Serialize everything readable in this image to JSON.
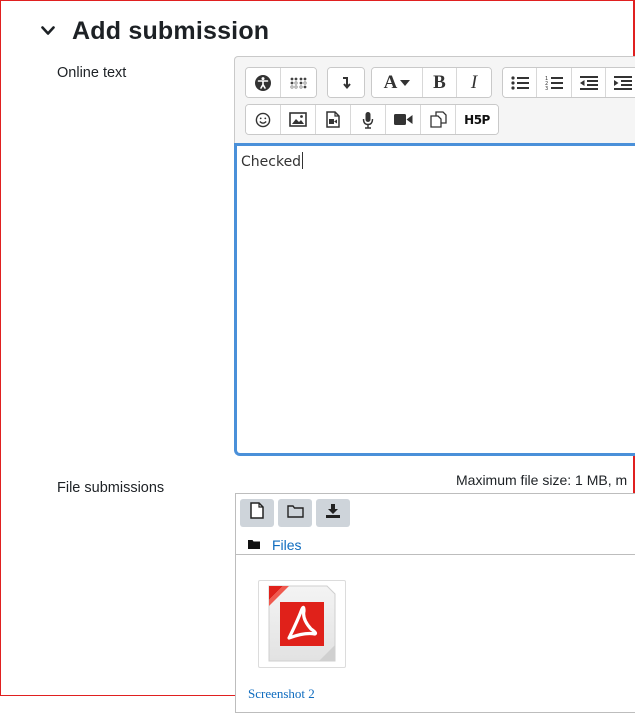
{
  "section": {
    "title": "Add submission",
    "collapse_icon": "chevron-down-icon"
  },
  "online_text": {
    "label": "Online text",
    "content": "Checked",
    "toolbar_row1": [
      "accessibility-checker-icon",
      "screen-reader-helper-icon",
      "show-more-icon",
      "font-style-icon",
      "bold-icon",
      "italic-icon",
      "unordered-list-icon",
      "ordered-list-icon",
      "outdent-icon",
      "indent-icon"
    ],
    "toolbar_row2": [
      "emoji-icon",
      "image-icon",
      "media-icon",
      "record-audio-icon",
      "record-video-icon",
      "manage-files-icon",
      "h5p-icon"
    ],
    "bold_label": "B",
    "italic_label": "I",
    "font_label": "A",
    "h5p_label": "H5P"
  },
  "file_submissions": {
    "label": "File submissions",
    "max_size": "Maximum file size: 1 MB, m",
    "toolbar": [
      "add-file-icon",
      "create-folder-icon",
      "download-icon"
    ],
    "path_label": "Files",
    "file_name": "Screenshot 2"
  },
  "colors": {
    "accent": "#0f6cbf",
    "editor_focus_border": "#4a90d9",
    "pdf_red": "#e0211a",
    "frame_border": "#e02020"
  }
}
